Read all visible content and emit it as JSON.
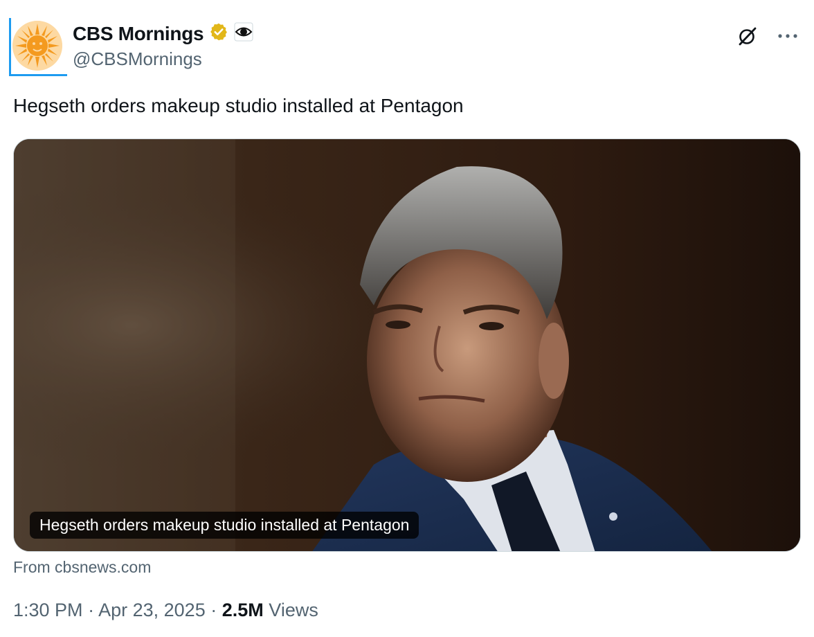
{
  "author": {
    "display_name": "CBS Mornings",
    "handle": "@CBSMornings",
    "verified_badge_color": "#e2b719",
    "affiliate_icon": "cbs-eye-icon",
    "avatar_icon": "sun-logo-icon",
    "avatar_bg": "#fdd9a2",
    "avatar_color": "#f49a1f"
  },
  "header_actions": {
    "grok_icon": "grok-icon",
    "more_icon": "more-icon"
  },
  "tweet": {
    "text": "Hegseth orders makeup studio installed at Pentagon"
  },
  "card": {
    "caption": "Hegseth orders makeup studio installed at Pentagon",
    "source": "From cbsnews.com"
  },
  "meta": {
    "time": "1:30 PM",
    "separator": "·",
    "date": "Apr 23, 2025",
    "views_count": "2.5M",
    "views_label": "Views"
  },
  "colors": {
    "accent": "#1d9bf0",
    "text": "#0f1419",
    "secondary": "#536471"
  }
}
